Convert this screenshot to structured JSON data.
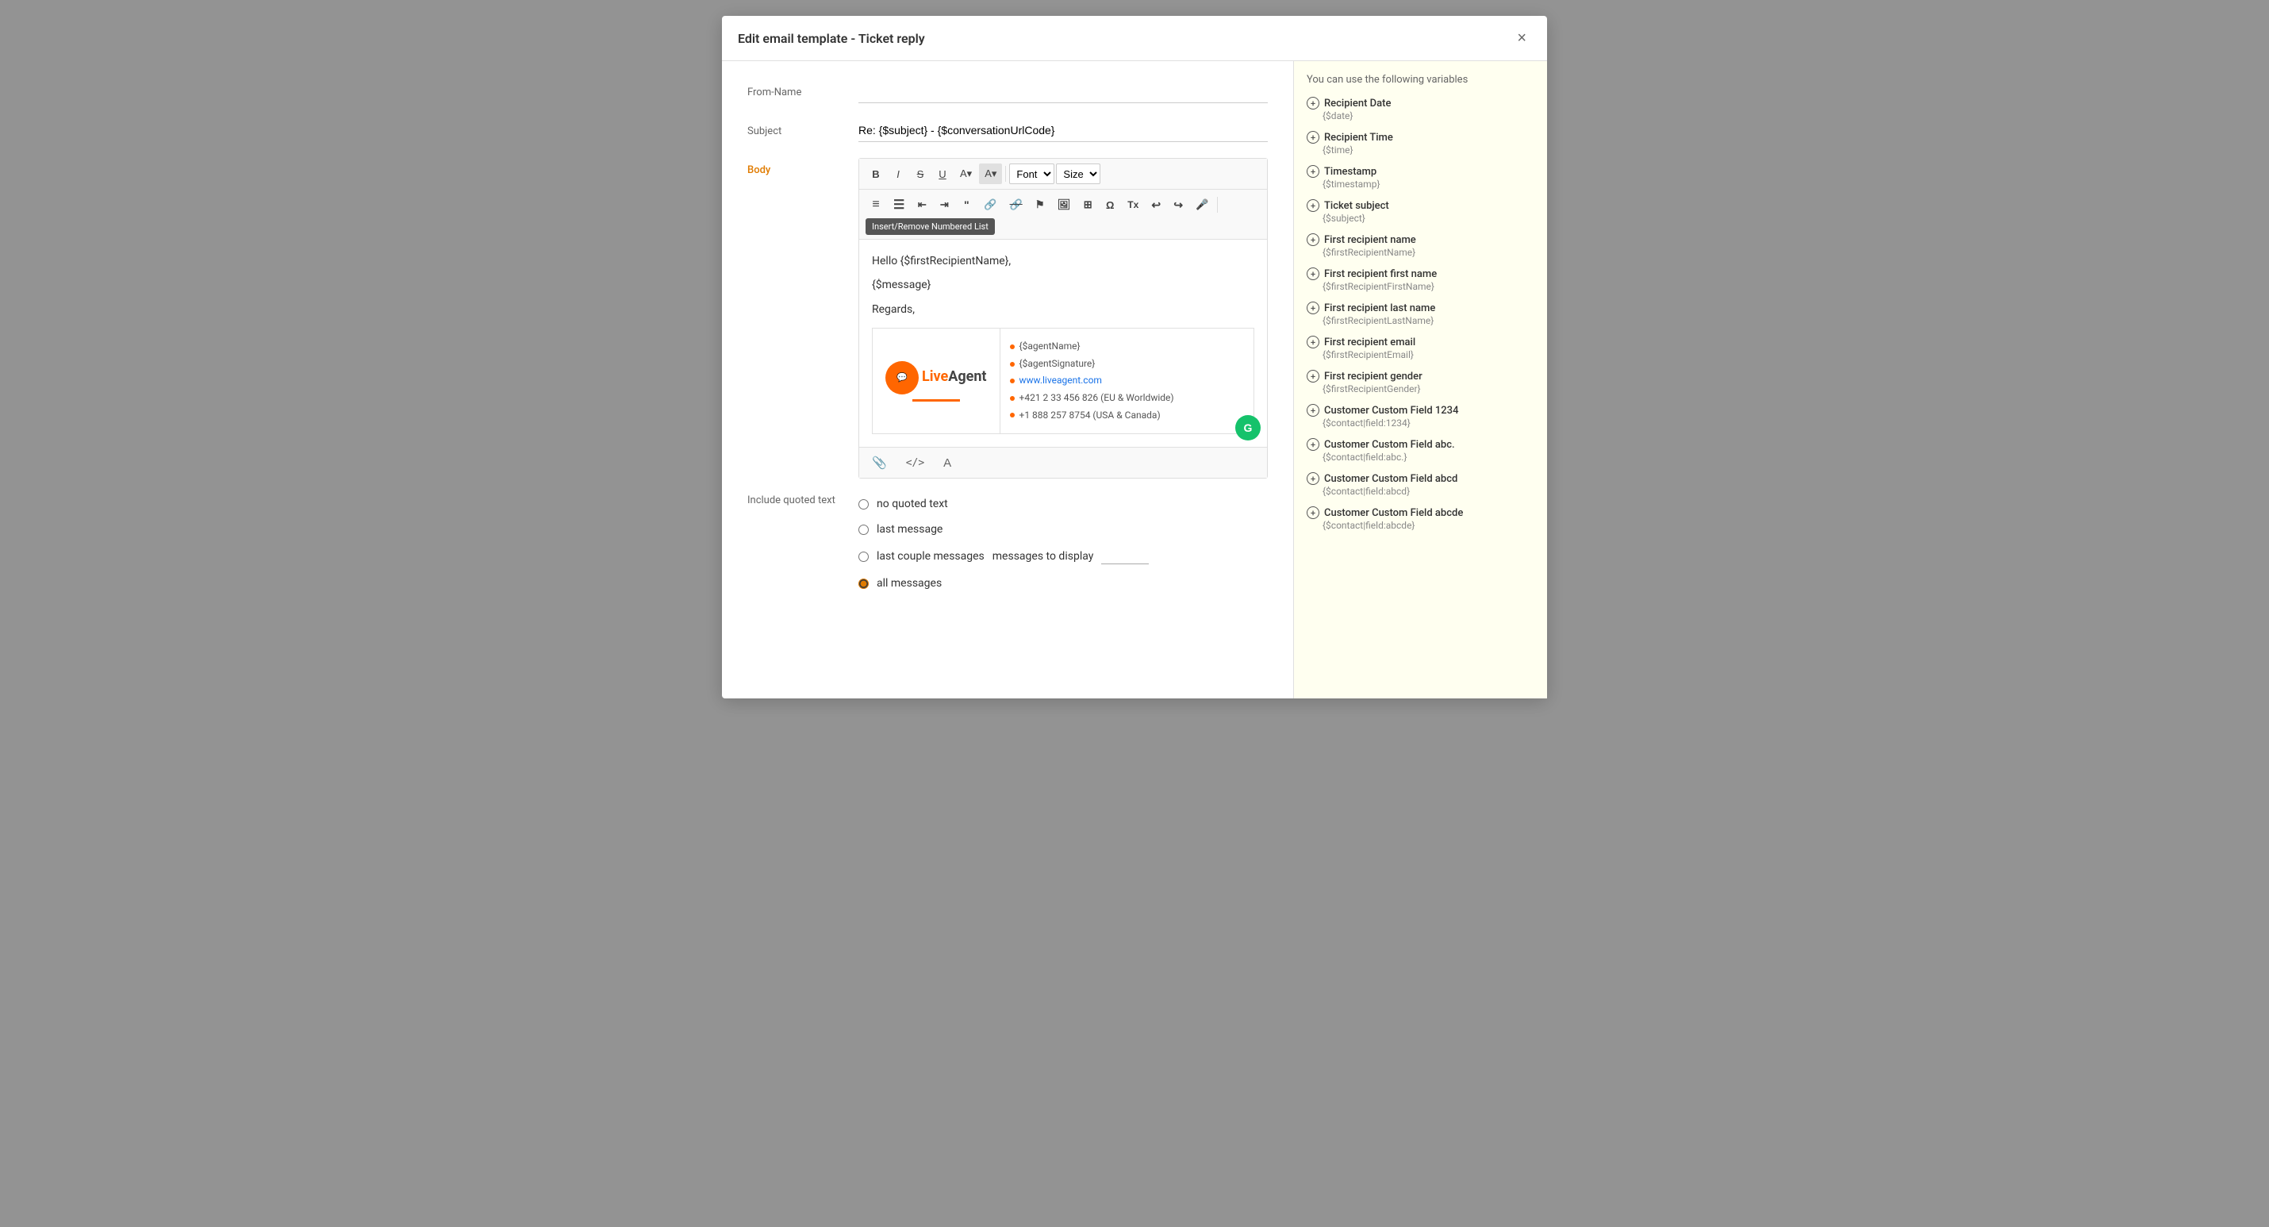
{
  "modal": {
    "title": "Edit email template - Ticket reply",
    "close_label": "×"
  },
  "form": {
    "from_name_label": "From-Name",
    "from_name_value": "",
    "from_name_placeholder": "",
    "subject_label": "Subject",
    "subject_value": "Re: {$subject} - {$conversationUrlCode}",
    "body_label": "Body",
    "quoted_text_label": "Include quoted text"
  },
  "toolbar": {
    "bold": "B",
    "italic": "I",
    "strikethrough": "S",
    "underline": "U",
    "font_color": "A",
    "highlight": "A",
    "font_label": "Font",
    "size_label": "Size",
    "ordered_list": "ordered-list",
    "unordered_list": "unordered-list",
    "indent": "indent",
    "outdent": "outdent",
    "blockquote": "blockquote",
    "link": "link",
    "unlink": "unlink",
    "flag": "flag",
    "image": "image",
    "table": "table",
    "omega": "Ω",
    "clear_format": "Tx",
    "undo": "undo",
    "redo": "redo",
    "mic": "mic",
    "source": "Source",
    "tooltip_text": "Insert/Remove Numbered List"
  },
  "editor": {
    "content_line1": "Hello {$firstRecipientName},",
    "content_line2": "{$message}",
    "content_line3": "Regards,"
  },
  "signature": {
    "logo_live": "Live",
    "logo_agent": "Agent",
    "agent_name": "{$agentName}",
    "agent_signature": "{$agentSignature}",
    "website": "www.liveagent.com",
    "phone_eu": "+421 2 33 456 826 (EU & Worldwide)",
    "phone_usa": "+1 888 257 8754 (USA & Canada)"
  },
  "editor_footer": {
    "attach_icon": "📎",
    "code_icon": "</>",
    "text_icon": "A"
  },
  "quoted_text": {
    "no_quoted": "no quoted text",
    "last_message": "last message",
    "last_couple": "last couple messages",
    "messages_to_display": "messages to display",
    "all_messages": "all messages"
  },
  "variables": {
    "title": "You can use the following variables",
    "items": [
      {
        "name": "Recipient Date",
        "code": "{$date}"
      },
      {
        "name": "Recipient Time",
        "code": "{$time}"
      },
      {
        "name": "Timestamp",
        "code": "{$timestamp}"
      },
      {
        "name": "Ticket subject",
        "code": "{$subject}"
      },
      {
        "name": "First recipient name",
        "code": "{$firstRecipientName}"
      },
      {
        "name": "First recipient first name",
        "code": "{$firstRecipientFirstName}"
      },
      {
        "name": "First recipient last name",
        "code": "{$firstRecipientLastName}"
      },
      {
        "name": "First recipient email",
        "code": "{$firstRecipientEmail}"
      },
      {
        "name": "First recipient gender",
        "code": "{$firstRecipientGender}"
      },
      {
        "name": "Customer Custom Field 1234",
        "code": "{$contact|field:1234}"
      },
      {
        "name": "Customer Custom Field abc.",
        "code": "{$contact|field:abc.}"
      },
      {
        "name": "Customer Custom Field abcd",
        "code": "{$contact|field:abcd}"
      },
      {
        "name": "Customer Custom Field abcde",
        "code": "{$contact|field:abcde}"
      }
    ]
  }
}
